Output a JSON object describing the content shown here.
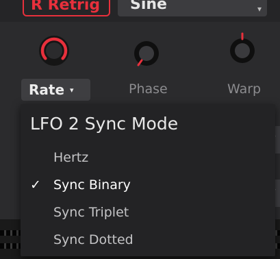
{
  "header": {
    "retrig_label": "R Retrig",
    "waveform_value": "Sine"
  },
  "params": {
    "rate": {
      "label": "Rate",
      "caret": "▾"
    },
    "phase": {
      "label": "Phase"
    },
    "warp": {
      "label": "Warp"
    }
  },
  "menu": {
    "title": "LFO 2 Sync Mode",
    "items": [
      {
        "label": "Hertz",
        "selected": false
      },
      {
        "label": "Sync Binary",
        "selected": true
      },
      {
        "label": "Sync Triplet",
        "selected": false
      },
      {
        "label": "Sync Dotted",
        "selected": false
      }
    ],
    "checkmark": "✓"
  },
  "colors": {
    "accent": "#e8303c",
    "background": "#2b2b2d",
    "menu_bg": "#232325"
  }
}
